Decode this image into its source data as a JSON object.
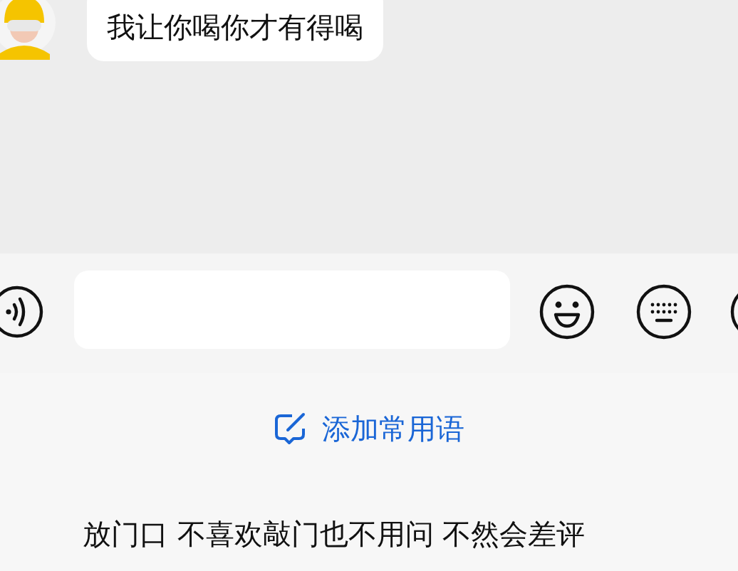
{
  "messages": [
    {
      "text": "我让你喝你才有得喝"
    }
  ],
  "quick_action": {
    "label": "添加常用语"
  },
  "phrases": [
    {
      "text": "放门口 不喜欢敲门也不用问 不然会差评"
    }
  ]
}
